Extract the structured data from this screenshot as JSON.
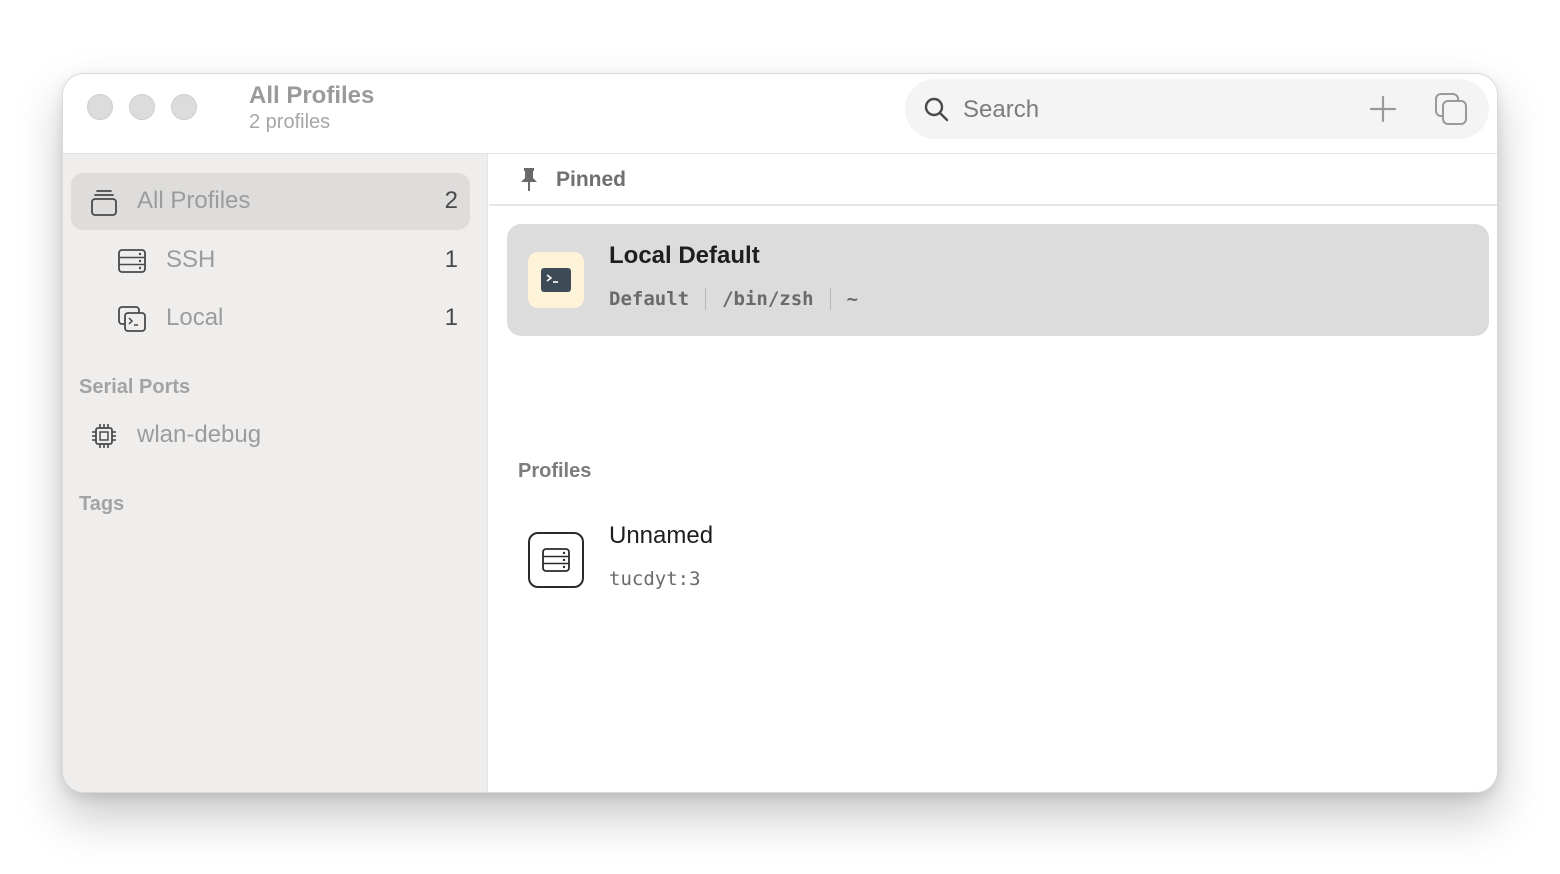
{
  "titlebar": {
    "title": "All Profiles",
    "subtitle": "2 profiles"
  },
  "search": {
    "placeholder": "Search",
    "icon": "search-icon"
  },
  "toolbar": {
    "add_icon": "plus-icon",
    "duplicate_icon": "duplicate-icon"
  },
  "sidebar": {
    "items": [
      {
        "label": "All Profiles",
        "count": "2",
        "icon": "stack-icon"
      },
      {
        "label": "SSH",
        "count": "1",
        "icon": "server-icon"
      },
      {
        "label": "Local",
        "count": "1",
        "icon": "terminal-windows-icon"
      }
    ],
    "serial_ports": {
      "header": "Serial Ports",
      "items": [
        {
          "label": "wlan-debug",
          "icon": "chip-icon"
        }
      ]
    },
    "tags": {
      "header": "Tags"
    }
  },
  "main": {
    "pinned": {
      "header": "Pinned",
      "icon": "pin-icon",
      "items": [
        {
          "name": "Local Default",
          "meta": [
            "Default",
            "/bin/zsh",
            "~"
          ],
          "icon": "terminal-icon",
          "badge_color": "#fdf3d8"
        }
      ]
    },
    "profiles": {
      "header": "Profiles",
      "items": [
        {
          "name": "Unnamed",
          "meta": [
            "tucdyt:3"
          ],
          "icon": "server-icon"
        }
      ]
    }
  },
  "colors": {
    "sidebar_bg": "#efeeed",
    "selected_bg": "#dcdcdc",
    "terminal_badge": "#fdf3d8",
    "terminal_icon": "#3c4b55"
  }
}
